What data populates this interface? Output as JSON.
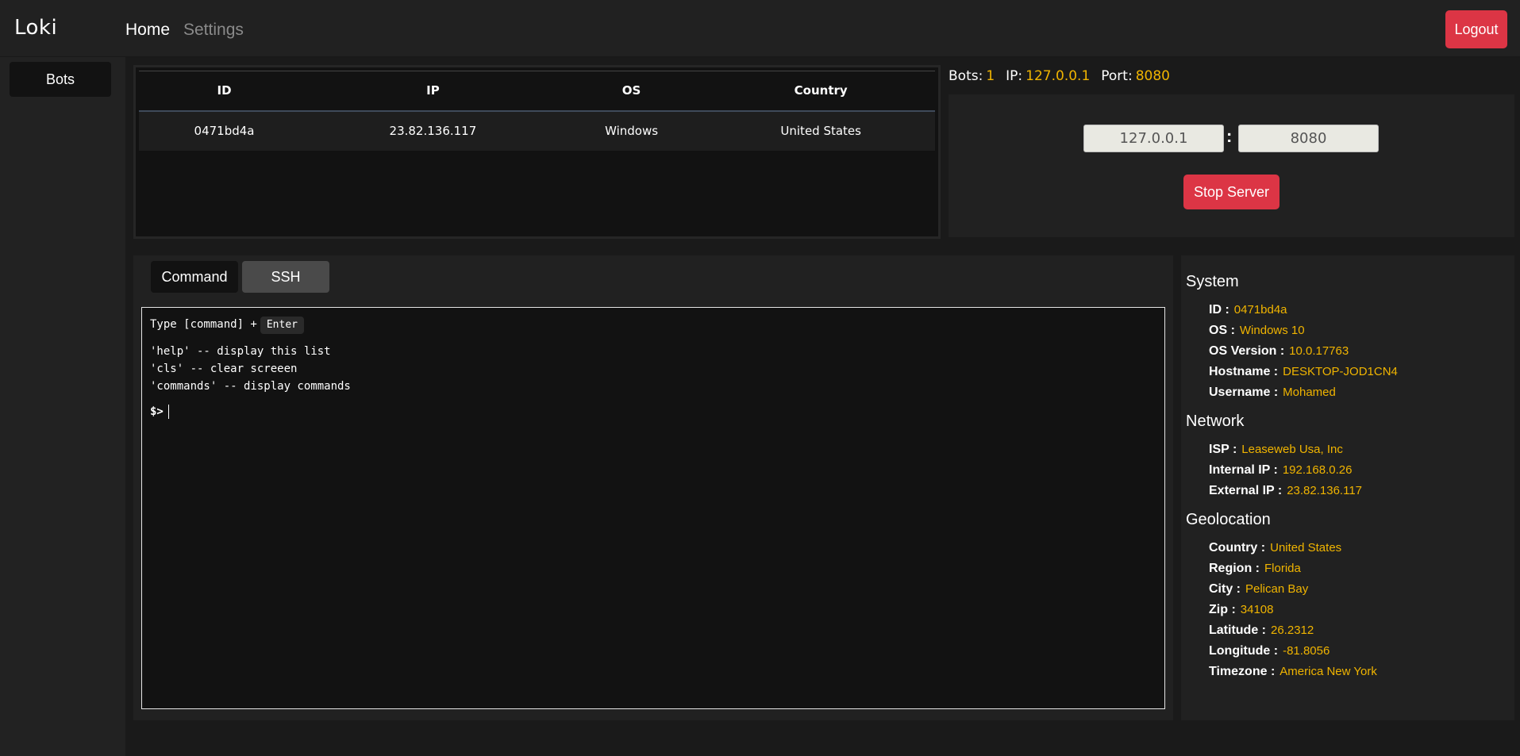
{
  "app": {
    "brand": "Loki"
  },
  "nav": {
    "home": "Home",
    "settings": "Settings",
    "logout": "Logout"
  },
  "sidebar": {
    "items": [
      {
        "label": "Bots"
      }
    ]
  },
  "bots_table": {
    "headers": [
      "ID",
      "IP",
      "OS",
      "Country"
    ],
    "rows": [
      [
        "0471bd4a",
        "23.82.136.117",
        "Windows",
        "United States"
      ]
    ]
  },
  "server": {
    "bots_label": "Bots:",
    "bots_value": "1",
    "ip_label": "IP:",
    "ip_value": "127.0.0.1",
    "port_label": "Port:",
    "port_value": "8080",
    "input_ip": "127.0.0.1",
    "colon": ":",
    "input_port": "8080",
    "stop_button": "Stop Server"
  },
  "tabs": {
    "command": "Command",
    "ssh": "SSH"
  },
  "terminal": {
    "hint_prefix": "Type [command] +",
    "hint_key": "Enter",
    "lines": [
      "'help' -- display this list",
      "'cls' -- clear screeen",
      "'commands' -- display commands"
    ],
    "prompt": "$>"
  },
  "details": {
    "system": {
      "title": "System",
      "rows": [
        {
          "key": "ID :",
          "value": "0471bd4a"
        },
        {
          "key": "OS :",
          "value": "Windows 10"
        },
        {
          "key": "OS Version :",
          "value": "10.0.17763"
        },
        {
          "key": "Hostname :",
          "value": "DESKTOP-JOD1CN4"
        },
        {
          "key": "Username :",
          "value": "Mohamed"
        }
      ]
    },
    "network": {
      "title": "Network",
      "rows": [
        {
          "key": "ISP :",
          "value": "Leaseweb Usa, Inc"
        },
        {
          "key": "Internal IP :",
          "value": "192.168.0.26"
        },
        {
          "key": "External IP :",
          "value": "23.82.136.117"
        }
      ]
    },
    "geolocation": {
      "title": "Geolocation",
      "rows": [
        {
          "key": "Country :",
          "value": "United States"
        },
        {
          "key": "Region :",
          "value": "Florida"
        },
        {
          "key": "City :",
          "value": "Pelican Bay"
        },
        {
          "key": "Zip :",
          "value": "34108"
        },
        {
          "key": "Latitude :",
          "value": "26.2312"
        },
        {
          "key": "Longitude :",
          "value": "-81.8056"
        },
        {
          "key": "Timezone :",
          "value": "America New York"
        }
      ]
    }
  },
  "colors": {
    "accent_yellow": "#f0b400",
    "danger_red": "#dc3545"
  }
}
